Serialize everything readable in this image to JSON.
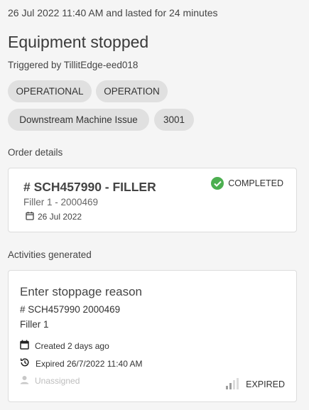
{
  "event": {
    "subtitle": "26 Jul 2022 11:40 AM and lasted for 24 minutes",
    "title": "Equipment stopped",
    "triggered_by": "Triggered by TillitEdge-eed018",
    "tags": [
      "OPERATIONAL",
      "OPERATION",
      "Downstream Machine Issue",
      "3001"
    ]
  },
  "order_section": {
    "label": "Order details",
    "order_title": "# SCH457990 - FILLER",
    "order_sub": "Filler 1 - 2000469",
    "date": "26 Jul 2022",
    "status": "COMPLETED",
    "status_color": "#4caf50"
  },
  "activities_section": {
    "label": "Activities generated",
    "activity": {
      "title": "Enter stoppage reason",
      "order": "# SCH457990 2000469",
      "machine": "Filler 1",
      "created": "Created 2 days ago",
      "expired": "Expired 26/7/2022 11:40 AM",
      "assignee": "Unassigned",
      "status": "EXPIRED"
    }
  }
}
